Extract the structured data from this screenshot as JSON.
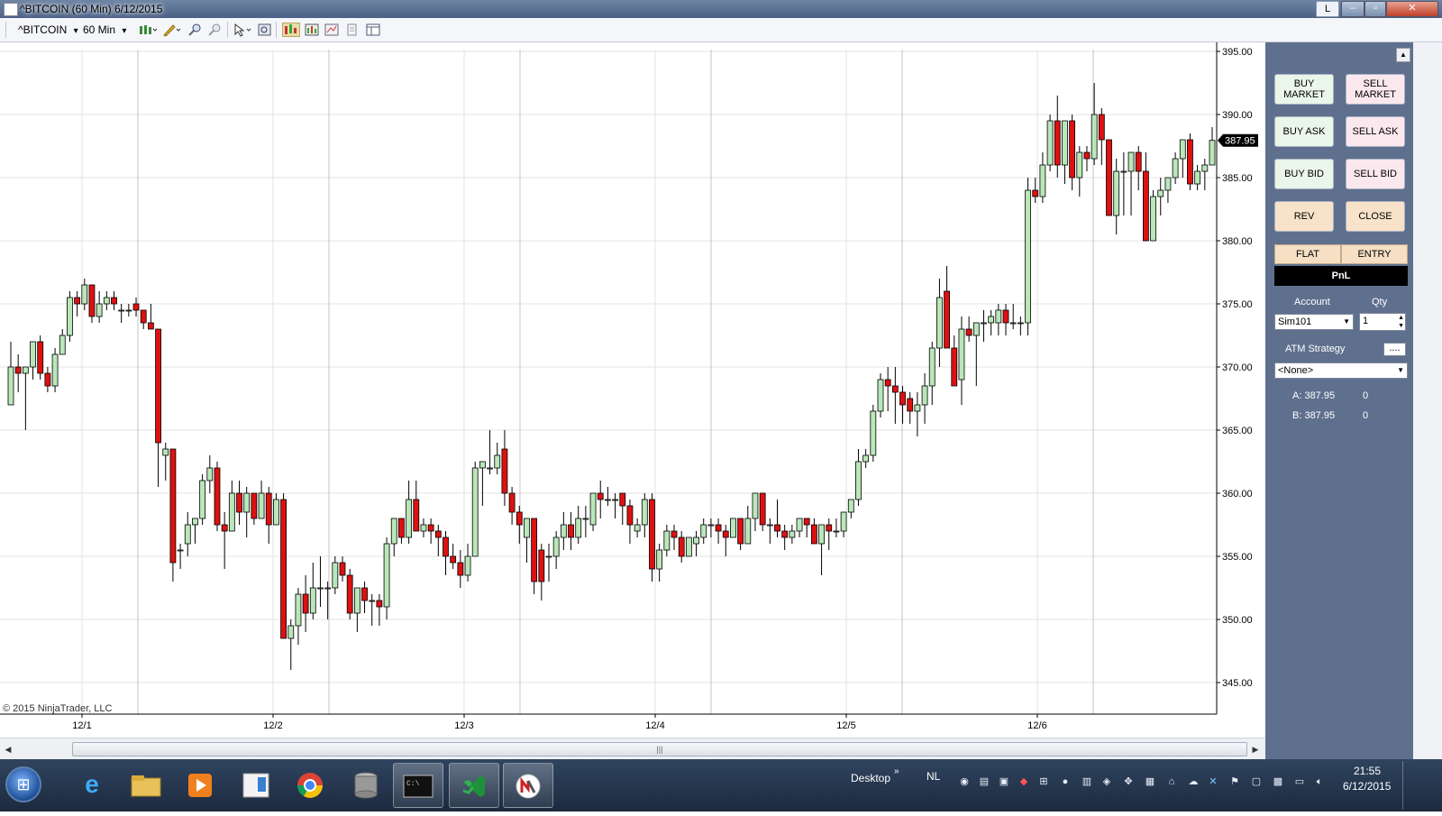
{
  "window": {
    "title": "^BITCOIN (60 Min)  6/12/2015",
    "layout_button": "L",
    "minimize": "–",
    "maximize": "▫",
    "close": "✕"
  },
  "toolbar": {
    "instrument": "^BITCOIN",
    "interval": "60 Min",
    "dropdown_arrow": "▾"
  },
  "chart_data": {
    "type": "candlestick",
    "instrument": "^BITCOIN",
    "interval": "60 Min",
    "ylim": [
      343,
      396
    ],
    "y_ticks": [
      "395.00",
      "390.00",
      "385.00",
      "380.00",
      "375.00",
      "370.00",
      "365.00",
      "360.00",
      "355.00",
      "350.00",
      "345.00"
    ],
    "x_ticks": [
      "12/1",
      "12/2",
      "12/3",
      "12/4",
      "12/5",
      "12/6"
    ],
    "last_price": "387.95",
    "colors": {
      "up": "#b9e7b9",
      "down": "#dd1111",
      "wick": "#000000",
      "grid": "#e3e3e3",
      "separator": "#c4c4c4"
    },
    "candles": [
      {
        "o": 367,
        "h": 372,
        "l": 367,
        "c": 370
      },
      {
        "o": 370,
        "h": 371,
        "l": 368,
        "c": 369.5
      },
      {
        "o": 369.5,
        "h": 370,
        "l": 365,
        "c": 370
      },
      {
        "o": 370,
        "h": 372,
        "l": 369,
        "c": 372
      },
      {
        "o": 372,
        "h": 372.5,
        "l": 369,
        "c": 369.5
      },
      {
        "o": 369.5,
        "h": 370,
        "l": 368,
        "c": 368.5
      },
      {
        "o": 368.5,
        "h": 371.5,
        "l": 368,
        "c": 371
      },
      {
        "o": 371,
        "h": 373,
        "l": 371,
        "c": 372.5
      },
      {
        "o": 372.5,
        "h": 376,
        "l": 372,
        "c": 375.5
      },
      {
        "o": 375.5,
        "h": 376,
        "l": 374,
        "c": 375
      },
      {
        "o": 375,
        "h": 377,
        "l": 374.5,
        "c": 376.5
      },
      {
        "o": 376.5,
        "h": 376.5,
        "l": 373.5,
        "c": 374
      },
      {
        "o": 374,
        "h": 376,
        "l": 373.5,
        "c": 375
      },
      {
        "o": 375,
        "h": 376,
        "l": 374.5,
        "c": 375.5
      },
      {
        "o": 375.5,
        "h": 376,
        "l": 374.5,
        "c": 375
      },
      {
        "o": 374.5,
        "h": 375,
        "l": 373.5,
        "c": 374.5
      },
      {
        "o": 374.5,
        "h": 375,
        "l": 374,
        "c": 374.5
      },
      {
        "o": 375,
        "h": 375.5,
        "l": 374,
        "c": 374.5
      },
      {
        "o": 374.5,
        "h": 374.5,
        "l": 373,
        "c": 373.5
      },
      {
        "o": 373.5,
        "h": 375,
        "l": 373,
        "c": 373
      },
      {
        "o": 373,
        "h": 373,
        "l": 360.5,
        "c": 364
      },
      {
        "o": 363,
        "h": 364,
        "l": 361,
        "c": 363.5
      },
      {
        "o": 363.5,
        "h": 363.5,
        "l": 353,
        "c": 354.5
      },
      {
        "o": 355.5,
        "h": 356,
        "l": 354,
        "c": 355.5
      },
      {
        "o": 356,
        "h": 358.5,
        "l": 355,
        "c": 357.5
      },
      {
        "o": 357.5,
        "h": 358,
        "l": 356,
        "c": 358
      },
      {
        "o": 358,
        "h": 361.5,
        "l": 357.5,
        "c": 361
      },
      {
        "o": 361,
        "h": 363,
        "l": 360,
        "c": 362
      },
      {
        "o": 362,
        "h": 362.5,
        "l": 357,
        "c": 357.5
      },
      {
        "o": 357.5,
        "h": 358.5,
        "l": 354,
        "c": 357
      },
      {
        "o": 357,
        "h": 361,
        "l": 357,
        "c": 360
      },
      {
        "o": 360,
        "h": 361,
        "l": 357.5,
        "c": 358.5
      },
      {
        "o": 358.5,
        "h": 360.5,
        "l": 356.5,
        "c": 360
      },
      {
        "o": 360,
        "h": 360,
        "l": 357.5,
        "c": 358
      },
      {
        "o": 358,
        "h": 361,
        "l": 358,
        "c": 360
      },
      {
        "o": 360,
        "h": 360.5,
        "l": 356,
        "c": 357.5
      },
      {
        "o": 357.5,
        "h": 360,
        "l": 357.5,
        "c": 359.5
      },
      {
        "o": 359.5,
        "h": 360,
        "l": 348.5,
        "c": 348.5
      },
      {
        "o": 348.5,
        "h": 350,
        "l": 346,
        "c": 349.5
      },
      {
        "o": 349.5,
        "h": 352.5,
        "l": 348,
        "c": 352
      },
      {
        "o": 352,
        "h": 353.5,
        "l": 349,
        "c": 350.5
      },
      {
        "o": 350.5,
        "h": 354.5,
        "l": 350,
        "c": 352.5
      },
      {
        "o": 352.5,
        "h": 355,
        "l": 351,
        "c": 352.5
      },
      {
        "o": 352.5,
        "h": 353,
        "l": 350,
        "c": 352.5
      },
      {
        "o": 352.5,
        "h": 355,
        "l": 352,
        "c": 354.5
      },
      {
        "o": 354.5,
        "h": 355,
        "l": 353,
        "c": 353.5
      },
      {
        "o": 353.5,
        "h": 354,
        "l": 350,
        "c": 350.5
      },
      {
        "o": 350.5,
        "h": 351.5,
        "l": 349,
        "c": 352.5
      },
      {
        "o": 352.5,
        "h": 353,
        "l": 350.5,
        "c": 351.5
      },
      {
        "o": 351.5,
        "h": 352,
        "l": 349.5,
        "c": 351.5
      },
      {
        "o": 351.5,
        "h": 352,
        "l": 349.5,
        "c": 351
      },
      {
        "o": 351,
        "h": 356.5,
        "l": 350,
        "c": 356
      },
      {
        "o": 356,
        "h": 358,
        "l": 355,
        "c": 358
      },
      {
        "o": 358,
        "h": 358,
        "l": 356,
        "c": 356.5
      },
      {
        "o": 356.5,
        "h": 361,
        "l": 356,
        "c": 359.5
      },
      {
        "o": 359.5,
        "h": 361,
        "l": 357,
        "c": 357
      },
      {
        "o": 357,
        "h": 358,
        "l": 356.5,
        "c": 357.5
      },
      {
        "o": 357.5,
        "h": 358,
        "l": 356,
        "c": 357
      },
      {
        "o": 357,
        "h": 357.5,
        "l": 355,
        "c": 356.5
      },
      {
        "o": 356.5,
        "h": 357,
        "l": 353.5,
        "c": 355
      },
      {
        "o": 355,
        "h": 356,
        "l": 354,
        "c": 354.5
      },
      {
        "o": 354.5,
        "h": 355.5,
        "l": 352.5,
        "c": 353.5
      },
      {
        "o": 353.5,
        "h": 356,
        "l": 353,
        "c": 355
      },
      {
        "o": 355,
        "h": 362.5,
        "l": 355,
        "c": 362
      },
      {
        "o": 362,
        "h": 362.5,
        "l": 359,
        "c": 362.5
      },
      {
        "o": 362,
        "h": 365,
        "l": 361.5,
        "c": 362
      },
      {
        "o": 362,
        "h": 364,
        "l": 361.5,
        "c": 363
      },
      {
        "o": 363.5,
        "h": 365,
        "l": 359,
        "c": 360
      },
      {
        "o": 360,
        "h": 360.5,
        "l": 357.5,
        "c": 358.5
      },
      {
        "o": 358.5,
        "h": 359,
        "l": 356,
        "c": 357.5
      },
      {
        "o": 356.5,
        "h": 358,
        "l": 354.5,
        "c": 358
      },
      {
        "o": 358,
        "h": 358,
        "l": 352,
        "c": 353
      },
      {
        "o": 355.5,
        "h": 356,
        "l": 351.5,
        "c": 353
      },
      {
        "o": 355,
        "h": 356,
        "l": 353,
        "c": 355
      },
      {
        "o": 355,
        "h": 357,
        "l": 354,
        "c": 356.5
      },
      {
        "o": 356.5,
        "h": 358.5,
        "l": 355.5,
        "c": 357.5
      },
      {
        "o": 357.5,
        "h": 358.5,
        "l": 355.5,
        "c": 356.5
      },
      {
        "o": 356.5,
        "h": 359,
        "l": 356,
        "c": 358
      },
      {
        "o": 358,
        "h": 359,
        "l": 356.5,
        "c": 358
      },
      {
        "o": 357.5,
        "h": 360,
        "l": 357,
        "c": 360
      },
      {
        "o": 360,
        "h": 361,
        "l": 358,
        "c": 359.5
      },
      {
        "o": 359.5,
        "h": 360.5,
        "l": 359,
        "c": 359.5
      },
      {
        "o": 359.5,
        "h": 360,
        "l": 358,
        "c": 359.5
      },
      {
        "o": 360,
        "h": 360,
        "l": 357.5,
        "c": 359
      },
      {
        "o": 359,
        "h": 359.5,
        "l": 356,
        "c": 357.5
      },
      {
        "o": 357,
        "h": 358,
        "l": 356.5,
        "c": 357.5
      },
      {
        "o": 357.5,
        "h": 360,
        "l": 356.5,
        "c": 359.5
      },
      {
        "o": 359.5,
        "h": 360,
        "l": 353,
        "c": 354
      },
      {
        "o": 354,
        "h": 356,
        "l": 353,
        "c": 355.5
      },
      {
        "o": 355.5,
        "h": 357.5,
        "l": 355,
        "c": 357
      },
      {
        "o": 357,
        "h": 357.5,
        "l": 355.5,
        "c": 356.5
      },
      {
        "o": 356.5,
        "h": 357,
        "l": 354.5,
        "c": 355
      },
      {
        "o": 355,
        "h": 356.5,
        "l": 355,
        "c": 356.5
      },
      {
        "o": 356,
        "h": 357,
        "l": 355,
        "c": 356.5
      },
      {
        "o": 356.5,
        "h": 358,
        "l": 356,
        "c": 357.5
      },
      {
        "o": 357.5,
        "h": 358,
        "l": 356.5,
        "c": 357.5
      },
      {
        "o": 357.5,
        "h": 358,
        "l": 356,
        "c": 357
      },
      {
        "o": 357,
        "h": 357.5,
        "l": 355,
        "c": 356.5
      },
      {
        "o": 356.5,
        "h": 358,
        "l": 356.5,
        "c": 358
      },
      {
        "o": 358,
        "h": 358,
        "l": 355.5,
        "c": 356
      },
      {
        "o": 356,
        "h": 359,
        "l": 356,
        "c": 358
      },
      {
        "o": 358,
        "h": 360,
        "l": 357,
        "c": 360
      },
      {
        "o": 360,
        "h": 360,
        "l": 357,
        "c": 357.5
      },
      {
        "o": 357.5,
        "h": 358,
        "l": 356,
        "c": 357.5
      },
      {
        "o": 357.5,
        "h": 359.5,
        "l": 356.5,
        "c": 357
      },
      {
        "o": 357,
        "h": 357.5,
        "l": 355.5,
        "c": 356.5
      },
      {
        "o": 356.5,
        "h": 357.5,
        "l": 356,
        "c": 357
      },
      {
        "o": 357,
        "h": 358,
        "l": 356.5,
        "c": 358
      },
      {
        "o": 358,
        "h": 358,
        "l": 356.5,
        "c": 357.5
      },
      {
        "o": 357.5,
        "h": 358,
        "l": 356,
        "c": 356
      },
      {
        "o": 356,
        "h": 357.5,
        "l": 353.5,
        "c": 357.5
      },
      {
        "o": 357.5,
        "h": 358,
        "l": 355.5,
        "c": 357
      },
      {
        "o": 357,
        "h": 358,
        "l": 356.5,
        "c": 357
      },
      {
        "o": 357,
        "h": 358.5,
        "l": 356.5,
        "c": 358.5
      },
      {
        "o": 358.5,
        "h": 359.5,
        "l": 358,
        "c": 359.5
      },
      {
        "o": 359.5,
        "h": 363.5,
        "l": 359,
        "c": 362.5
      },
      {
        "o": 362.5,
        "h": 363.5,
        "l": 362,
        "c": 363
      },
      {
        "o": 363,
        "h": 367,
        "l": 362.5,
        "c": 366.5
      },
      {
        "o": 366.5,
        "h": 369.5,
        "l": 366,
        "c": 369
      },
      {
        "o": 369,
        "h": 370,
        "l": 366.5,
        "c": 368.5
      },
      {
        "o": 368.5,
        "h": 370,
        "l": 365.5,
        "c": 368
      },
      {
        "o": 368,
        "h": 368.5,
        "l": 365.5,
        "c": 367
      },
      {
        "o": 367.5,
        "h": 368,
        "l": 365.5,
        "c": 366.5
      },
      {
        "o": 366.5,
        "h": 368,
        "l": 364.5,
        "c": 367
      },
      {
        "o": 367,
        "h": 369.5,
        "l": 365.5,
        "c": 368.5
      },
      {
        "o": 368.5,
        "h": 372,
        "l": 367,
        "c": 371.5
      },
      {
        "o": 371.5,
        "h": 377,
        "l": 370,
        "c": 375.5
      },
      {
        "o": 376,
        "h": 378,
        "l": 372,
        "c": 371.5
      },
      {
        "o": 371.5,
        "h": 372.5,
        "l": 369,
        "c": 368.5
      },
      {
        "o": 369,
        "h": 374,
        "l": 367,
        "c": 373
      },
      {
        "o": 373,
        "h": 374,
        "l": 372,
        "c": 372.5
      },
      {
        "o": 372.5,
        "h": 373.5,
        "l": 368.5,
        "c": 373.5
      },
      {
        "o": 373.5,
        "h": 374.5,
        "l": 372,
        "c": 373.5
      },
      {
        "o": 373.5,
        "h": 374.5,
        "l": 372.5,
        "c": 374
      },
      {
        "o": 373.5,
        "h": 375,
        "l": 372.5,
        "c": 374.5
      },
      {
        "o": 374.5,
        "h": 375,
        "l": 372.5,
        "c": 373.5
      },
      {
        "o": 373.5,
        "h": 375,
        "l": 373,
        "c": 373.5
      },
      {
        "o": 373.5,
        "h": 374,
        "l": 372.5,
        "c": 373.5
      },
      {
        "o": 373.5,
        "h": 385,
        "l": 372.5,
        "c": 384
      },
      {
        "o": 384,
        "h": 385,
        "l": 383,
        "c": 383.5
      },
      {
        "o": 383.5,
        "h": 387,
        "l": 383,
        "c": 386
      },
      {
        "o": 386,
        "h": 390,
        "l": 385.5,
        "c": 389.5
      },
      {
        "o": 389.5,
        "h": 391.5,
        "l": 385,
        "c": 386
      },
      {
        "o": 386,
        "h": 389.5,
        "l": 384.5,
        "c": 389.5
      },
      {
        "o": 389.5,
        "h": 390,
        "l": 384,
        "c": 385
      },
      {
        "o": 385,
        "h": 387.5,
        "l": 383.5,
        "c": 387
      },
      {
        "o": 387,
        "h": 387.5,
        "l": 385.5,
        "c": 386.5
      },
      {
        "o": 386.5,
        "h": 392.5,
        "l": 386,
        "c": 390
      },
      {
        "o": 390,
        "h": 390.5,
        "l": 386,
        "c": 388
      },
      {
        "o": 388,
        "h": 388,
        "l": 382,
        "c": 382
      },
      {
        "o": 382,
        "h": 386.5,
        "l": 380.5,
        "c": 385.5
      },
      {
        "o": 385.5,
        "h": 387,
        "l": 382,
        "c": 385.5
      },
      {
        "o": 385.5,
        "h": 387,
        "l": 382,
        "c": 387
      },
      {
        "o": 387,
        "h": 387.5,
        "l": 384,
        "c": 385.5
      },
      {
        "o": 385.5,
        "h": 387,
        "l": 380,
        "c": 380
      },
      {
        "o": 380,
        "h": 384,
        "l": 380,
        "c": 383.5
      },
      {
        "o": 383.5,
        "h": 385,
        "l": 382,
        "c": 384
      },
      {
        "o": 384,
        "h": 385,
        "l": 383,
        "c": 385
      },
      {
        "o": 385,
        "h": 387,
        "l": 384.5,
        "c": 386.5
      },
      {
        "o": 386.5,
        "h": 388,
        "l": 385,
        "c": 388
      },
      {
        "o": 388,
        "h": 388.5,
        "l": 384,
        "c": 384.5
      },
      {
        "o": 384.5,
        "h": 386,
        "l": 384,
        "c": 385.5
      },
      {
        "o": 385.5,
        "h": 386.5,
        "l": 384,
        "c": 386
      },
      {
        "o": 386,
        "h": 389,
        "l": 386,
        "c": 387.95
      }
    ],
    "copyright": "© 2015 NinjaTrader, LLC"
  },
  "order_panel": {
    "buttons": {
      "buy_market": "BUY MARKET",
      "sell_market": "SELL MARKET",
      "buy_ask": "BUY ASK",
      "sell_ask": "SELL ASK",
      "buy_bid": "BUY BID",
      "sell_bid": "SELL BID",
      "rev": "REV",
      "close": "CLOSE"
    },
    "position": "FLAT",
    "entry": "ENTRY",
    "pnl": "PnL",
    "account_label": "Account",
    "account_value": "Sim101",
    "qty_label": "Qty",
    "qty_value": "1",
    "atm_label": "ATM Strategy",
    "atm_more": "....",
    "atm_value": "<None>",
    "ask": "A: 387.95",
    "ask_size": "0",
    "bid": "B: 387.95",
    "bid_size": "0"
  },
  "taskbar": {
    "desktop_label": "Desktop",
    "language": "NL",
    "time": "21:55",
    "date": "6/12/2015"
  }
}
